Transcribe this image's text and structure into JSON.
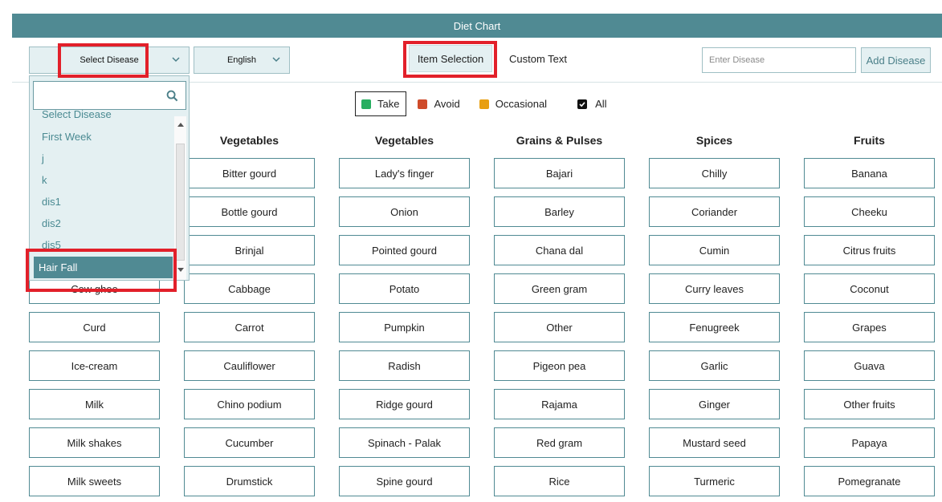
{
  "title": "Diet Chart",
  "toolbar": {
    "disease_select": "Select Disease",
    "language_select": "English",
    "item_selection_tab": "Item Selection",
    "custom_text_tab": "Custom Text",
    "enter_disease_placeholder": "Enter Disease",
    "add_disease_button": "Add Disease"
  },
  "legend": {
    "take": "Take",
    "avoid": "Avoid",
    "occasional": "Occasional",
    "all": "All",
    "colors": {
      "take": "#27ae60",
      "avoid": "#cf4b2a",
      "occasional": "#e89f10"
    }
  },
  "dropdown": {
    "items": [
      "Select Disease",
      "First Week",
      "j",
      "k",
      "dis1",
      "dis2",
      "dis5"
    ],
    "highlighted": "Hair Fall"
  },
  "columns": [
    {
      "header": "",
      "items": [
        "",
        "",
        "",
        "Cow ghee",
        "Curd",
        "Ice-cream",
        "Milk",
        "Milk shakes",
        "Milk sweets"
      ]
    },
    {
      "header": "Vegetables",
      "items": [
        "Bitter gourd",
        "Bottle gourd",
        "Brinjal",
        "Cabbage",
        "Carrot",
        "Cauliflower",
        "Chino podium",
        "Cucumber",
        "Drumstick"
      ]
    },
    {
      "header": "Vegetables",
      "items": [
        "Lady's finger",
        "Onion",
        "Pointed gourd",
        "Potato",
        "Pumpkin",
        "Radish",
        "Ridge gourd",
        "Spinach - Palak",
        "Spine gourd"
      ]
    },
    {
      "header": "Grains & Pulses",
      "items": [
        "Bajari",
        "Barley",
        "Chana dal",
        "Green gram",
        "Other",
        "Pigeon pea",
        "Rajama",
        "Red gram",
        "Rice"
      ]
    },
    {
      "header": "Spices",
      "items": [
        "Chilly",
        "Coriander",
        "Cumin",
        "Curry leaves",
        "Fenugreek",
        "Garlic",
        "Ginger",
        "Mustard seed",
        "Turmeric"
      ]
    },
    {
      "header": "Fruits",
      "items": [
        "Banana",
        "Cheeku",
        "Citrus fruits",
        "Coconut",
        "Grapes",
        "Guava",
        "Other fruits",
        "Papaya",
        "Pomegranate"
      ]
    }
  ]
}
